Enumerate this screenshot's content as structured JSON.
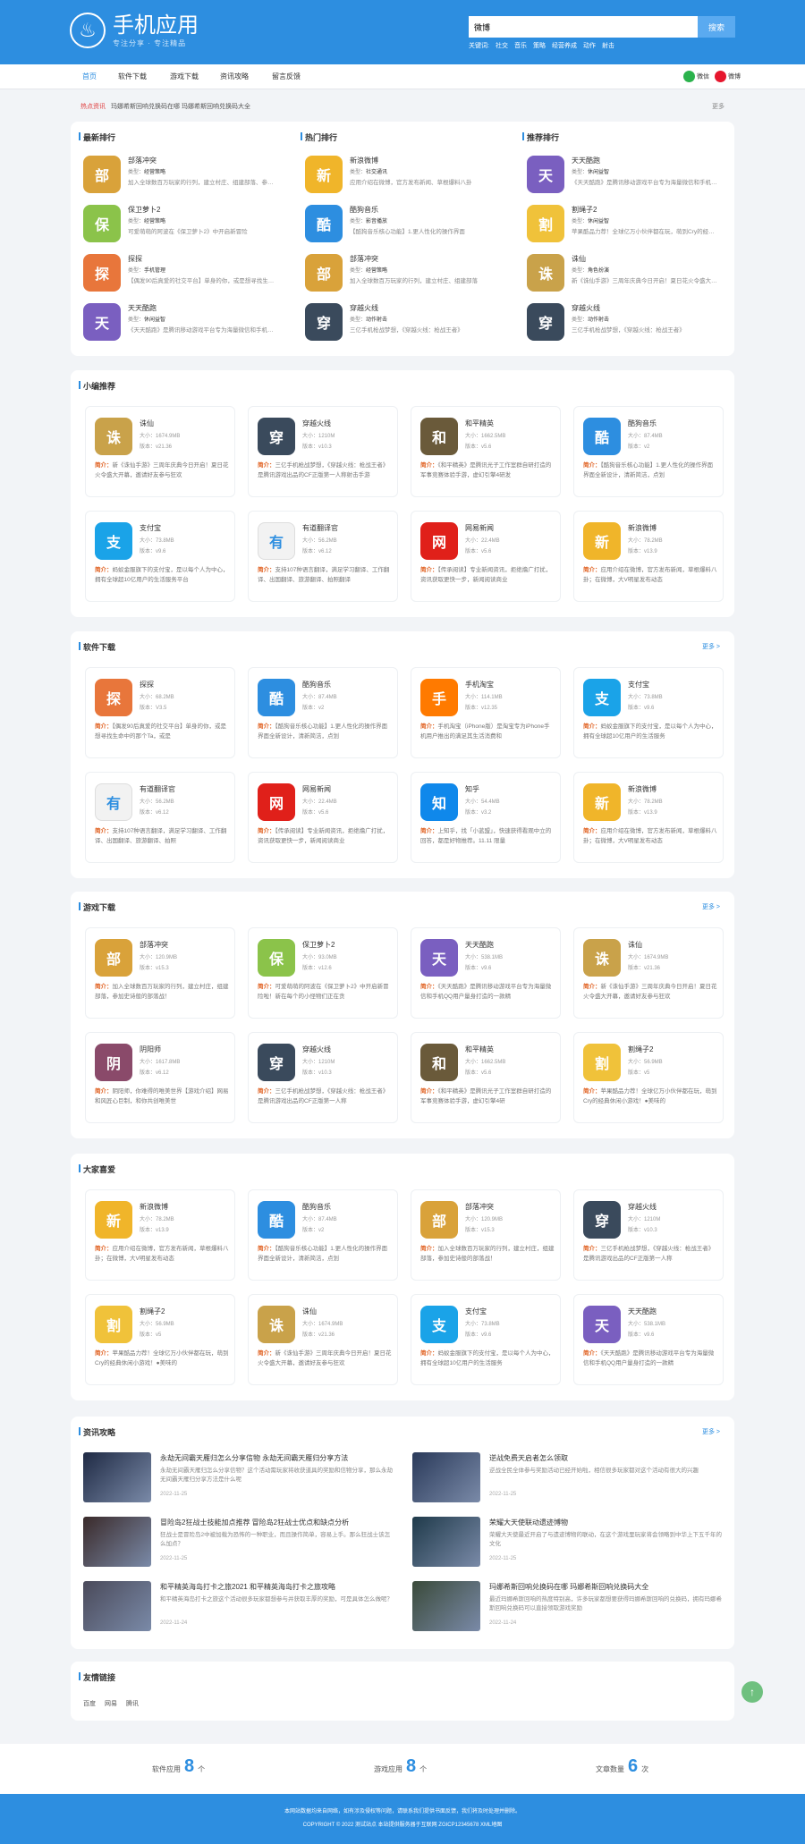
{
  "header": {
    "logo_text": "手机应用",
    "logo_sub": "专注分享 · 专注精品",
    "search_value": "微博",
    "search_button": "搜索",
    "keywords_label": "关键词:",
    "keywords": [
      "社交",
      "音乐",
      "策略",
      "经营养成",
      "动作",
      "射击"
    ]
  },
  "nav": {
    "items": [
      "首页",
      "软件下载",
      "游戏下载",
      "资讯攻略",
      "留言反馈"
    ],
    "share": [
      "微信",
      "微博"
    ]
  },
  "news_bar": {
    "label": "热点资讯",
    "text": "玛娜希斯回响兑换码在哪 玛娜希斯回响兑换码大全",
    "more": "更多"
  },
  "rank": {
    "columns": [
      {
        "title": "最新排行",
        "items": [
          {
            "name": "部落冲突",
            "type": "经营策略",
            "desc": "加入全球数百万玩家的行列，建立村庄、组建部落、参加史诗般的部落战"
          },
          {
            "name": "保卫萝卜2",
            "type": "经营策略",
            "desc": "可爱萌萌的阿波在《保卫萝卜2》中开启新冒险"
          },
          {
            "name": "探探",
            "type": "手机管理",
            "desc": "【偶发90后真爱的社交平台】单身的你，或是想寻找生命中的那个Ta"
          },
          {
            "name": "天天酷跑",
            "type": "休闲益智",
            "desc": "《天天酷跑》是腾讯移动游戏平台专为海量微信和手机QQ用户打造"
          }
        ]
      },
      {
        "title": "热门排行",
        "items": [
          {
            "name": "新浪微博",
            "type": "社交通讯",
            "desc": "应用介绍在微博，官方发布新闻、草根爆料八卦"
          },
          {
            "name": "酷狗音乐",
            "type": "影音播放",
            "desc": "【酷狗音乐核心功能】1.更人性化的操作界面"
          },
          {
            "name": "部落冲突",
            "type": "经营策略",
            "desc": "加入全球数百万玩家的行列，建立村庄、组建部落"
          },
          {
            "name": "穿越火线",
            "type": "动作射击",
            "desc": "三亿手机枪战梦想，《穿越火线：枪战王者》"
          }
        ]
      },
      {
        "title": "推荐排行",
        "items": [
          {
            "name": "天天酷跑",
            "type": "休闲益智",
            "desc": "《天天酷跑》是腾讯移动游戏平台专为海量微信和手机QQ用户打造"
          },
          {
            "name": "割绳子2",
            "type": "休闲益智",
            "desc": "苹果酷品力荐！全球亿万小伙伴都在玩，萌到Cry的经典休闲小游戏"
          },
          {
            "name": "诛仙",
            "type": "角色扮演",
            "desc": "新《诛仙手游》三周年庆典今日开启！夏日花火令盛大开幕"
          },
          {
            "name": "穿越火线",
            "type": "动作射击",
            "desc": "三亿手机枪战梦想，《穿越火线：枪战王者》"
          }
        ]
      }
    ]
  },
  "sections": [
    {
      "title": "小编推荐",
      "more": "",
      "items": [
        {
          "name": "诛仙",
          "size": "大小：1674.9MB",
          "ver": "版本：v21.36",
          "desc": "新《诛仙手游》三周年庆典今日开启！夏日花火令盛大开幕，邀请好友参与狂欢"
        },
        {
          "name": "穿越火线",
          "size": "大小：1210M",
          "ver": "版本：v10.3",
          "desc": "三亿手机枪战梦想，《穿越火线：枪战王者》是腾讯游戏出品的CF正版第一人称射击手游"
        },
        {
          "name": "和平精英",
          "size": "大小：1662.5MB",
          "ver": "版本：v5.6",
          "desc": "《和平精英》是腾讯光子工作室群自研打造的军事竞赛体验手游，虚幻引擎4研发"
        },
        {
          "name": "酷狗音乐",
          "size": "大小：87.4MB",
          "ver": "版本：v2",
          "desc": "【酷狗音乐核心功能】1.更人性化的操作界面界面全新设计，清新简洁，点划"
        },
        {
          "name": "支付宝",
          "size": "大小：73.8MB",
          "ver": "版本：v9.6",
          "desc": "蚂蚁金服旗下的支付宝，是以每个人为中心，拥有全球超10亿用户的生活服务平台"
        },
        {
          "name": "有道翻译官",
          "size": "大小：56.2MB",
          "ver": "版本：v6.12",
          "desc": "支持107种语言翻译，满足学习翻译、工作翻译、出国翻译、旅游翻译、拍照翻译"
        },
        {
          "name": "网易新闻",
          "size": "大小：22.4MB",
          "ver": "版本：v5.6",
          "desc": "【传承阅读】专业新闻资讯，拒绝撸广打扰，资讯获取更快一步，新闻阅读商业"
        },
        {
          "name": "新浪微博",
          "size": "大小：78.2MB",
          "ver": "版本：v13.9",
          "desc": "应用介绍在微博，官方发布新闻，草根爆料八卦；在微博，大V明星发布动态"
        }
      ]
    },
    {
      "title": "软件下载",
      "more": "更多 >",
      "items": [
        {
          "name": "探探",
          "size": "大小：68.2MB",
          "ver": "版本：V3.5",
          "desc": "【偶发90后真爱的社交平台】单身的你，或是想寻找生命中的那个Ta，或是"
        },
        {
          "name": "酷狗音乐",
          "size": "大小：87.4MB",
          "ver": "版本：v2",
          "desc": "【酷狗音乐核心功能】1.更人性化的操作界面界面全新设计，清新简洁，点划"
        },
        {
          "name": "手机淘宝",
          "size": "大小：114.1MB",
          "ver": "版本：v12.35",
          "desc": "手机淘宝（iPhone版）是淘宝专为iPhone手机用户推出的满足其生活消费和"
        },
        {
          "name": "支付宝",
          "size": "大小：73.8MB",
          "ver": "版本：v9.6",
          "desc": "蚂蚁金服旗下的支付宝，是以每个人为中心，拥有全球超10亿用户的生活服务"
        },
        {
          "name": "有道翻译官",
          "size": "大小：56.2MB",
          "ver": "版本：v6.12",
          "desc": "支持107种语言翻译，满足学习翻译、工作翻译、出国翻译、旅游翻译、拍照"
        },
        {
          "name": "网易新闻",
          "size": "大小：22.4MB",
          "ver": "版本：v5.6",
          "desc": "【传承阅读】专业新闻资讯，拒绝撸广打扰，资讯获取更快一步，新闻阅读商业"
        },
        {
          "name": "知乎",
          "size": "大小：54.4MB",
          "ver": "版本：v3.2",
          "desc": "上知乎，找「小蓝盟」，快速获得看观中立的回答，都是好物推荐。11.11 限量"
        },
        {
          "name": "新浪微博",
          "size": "大小：78.2MB",
          "ver": "版本：v13.9",
          "desc": "应用介绍在微博，官方发布新闻，草根爆料八卦；在微博，大V明星发布动态"
        }
      ]
    },
    {
      "title": "游戏下载",
      "more": "更多 >",
      "items": [
        {
          "name": "部落冲突",
          "size": "大小：120.9MB",
          "ver": "版本：v15.3",
          "desc": "加入全球数百万玩家的行列，建立村庄，组建部落，参加史诗般的部落战！"
        },
        {
          "name": "保卫萝卜2",
          "size": "大小：93.0MB",
          "ver": "版本：v12.6",
          "desc": "可爱萌萌的阿波在《保卫萝卜2》中开启新冒险啦！新在每个的小怪物们正在贪"
        },
        {
          "name": "天天酷跑",
          "size": "大小：538.1MB",
          "ver": "版本：v9.6",
          "desc": "《天天酷跑》是腾讯移动游戏平台专为海量微信和手机QQ用户量身打造的一款精"
        },
        {
          "name": "诛仙",
          "size": "大小：1674.9MB",
          "ver": "版本：v21.36",
          "desc": "新《诛仙手游》三周年庆典今日开启！夏日花火令盛大开幕，邀请好友参与狂欢"
        },
        {
          "name": "阴阳师",
          "size": "大小：1617.8MB",
          "ver": "版本：v6.12",
          "desc": "阴阳师，你难得的唯美世界【游戏介绍】网易和风匠心巨制，和你共创唯美世"
        },
        {
          "name": "穿越火线",
          "size": "大小：1210M",
          "ver": "版本：v10.3",
          "desc": "三亿手机枪战梦想，《穿越火线：枪战王者》是腾讯游戏出品的CF正版第一人称"
        },
        {
          "name": "和平精英",
          "size": "大小：1662.5MB",
          "ver": "版本：v5.6",
          "desc": "《和平精英》是腾讯光子工作室群自研打造的军事竞赛体验手游，虚幻引擎4研"
        },
        {
          "name": "割绳子2",
          "size": "大小：56.9MB",
          "ver": "版本：v5",
          "desc": "苹果酷品力荐！全球亿万小伙伴都在玩，萌到Cry的经典休闲小游戏！●美味的"
        }
      ]
    },
    {
      "title": "大家喜爱",
      "more": "",
      "items": [
        {
          "name": "新浪微博",
          "size": "大小：78.2MB",
          "ver": "版本：v13.9",
          "desc": "应用介绍在微博，官方发布新闻，草根爆料八卦；在微博，大V明星发布动态"
        },
        {
          "name": "酷狗音乐",
          "size": "大小：87.4MB",
          "ver": "版本：v2",
          "desc": "【酷狗音乐核心功能】1.更人性化的操作界面界面全新设计，清新简洁，点划"
        },
        {
          "name": "部落冲突",
          "size": "大小：120.9MB",
          "ver": "版本：v15.3",
          "desc": "加入全球数百万玩家的行列，建立村庄，组建部落，参加史诗般的部落战！"
        },
        {
          "name": "穿越火线",
          "size": "大小：1210M",
          "ver": "版本：v10.3",
          "desc": "三亿手机枪战梦想，《穿越火线：枪战王者》是腾讯游戏出品的CF正版第一人称"
        },
        {
          "name": "割绳子2",
          "size": "大小：56.9MB",
          "ver": "版本：v5",
          "desc": "苹果酷品力荐！全球亿万小伙伴都在玩，萌到Cry的经典休闲小游戏！●美味的"
        },
        {
          "name": "诛仙",
          "size": "大小：1674.9MB",
          "ver": "版本：v21.36",
          "desc": "新《诛仙手游》三周年庆典今日开启！夏日花火令盛大开幕，邀请好友参与狂欢"
        },
        {
          "name": "支付宝",
          "size": "大小：73.8MB",
          "ver": "版本：v9.6",
          "desc": "蚂蚁金服旗下的支付宝，是以每个人为中心，拥有全球超10亿用户的生活服务"
        },
        {
          "name": "天天酷跑",
          "size": "大小：538.1MB",
          "ver": "版本：v9.6",
          "desc": "《天天酷跑》是腾讯移动游戏平台专为海量微信和手机QQ用户量身打造的一款精"
        }
      ]
    }
  ],
  "desc_label": "简介：",
  "articles": {
    "title": "资讯攻略",
    "more": "更多 >",
    "items": [
      {
        "title": "永劫无间霸天雁归怎么分享信物 永劫无间霸天雁归分享方法",
        "desc": "永劫无间霸天雁归怎么分享信物？这个活动需玩家将收获道具的奖励和信物分享，那么永劫无间霸天雁归分享方法是什么呢",
        "date": "2022-11-25"
      },
      {
        "title": "逆战免费天启者怎么领取",
        "desc": "逆战全民全体参与奖励活动已经开始啦，相信很多玩家都对这个活动有很大的兴趣",
        "date": "2022-11-25"
      },
      {
        "title": "冒险岛2狂战士技能加点推荐 冒险岛2狂战士优点和缺点分析",
        "desc": "狂战士是冒险岛2中被加载为恐怖的一种职业，而且操作简单，容易上手。那么狂战士该怎么加点？",
        "date": "2022-11-25"
      },
      {
        "title": "荣耀大天使联动遗迹博物",
        "desc": "荣耀大天使最近开启了与遗迹博物的联动，在这个游戏里玩家将会领略到中华上下五千年的文化",
        "date": "2022-11-25"
      },
      {
        "title": "和平精英海岛打卡之旅2021 和平精英海岛打卡之旅攻略",
        "desc": "和平精英海岛打卡之旅这个活动很多玩家都想参与并获取丰厚的奖励，可是具体怎么做呢？",
        "date": "2022-11-24"
      },
      {
        "title": "玛娜希斯回响兑换码在哪 玛娜希斯回响兑换码大全",
        "desc": "最近玛娜希斯回响的热度特别高，许多玩家都想要获得玛娜希斯回响的兑换码，拥有玛娜希斯回响兑换码可以直接领取游戏奖励",
        "date": "2022-11-24"
      }
    ]
  },
  "friends": {
    "title": "友情链接",
    "items": [
      "百度",
      "网易",
      "腾讯"
    ]
  },
  "stats": [
    {
      "label": "软件应用",
      "value": "8",
      "unit": "个"
    },
    {
      "label": "游戏应用",
      "value": "8",
      "unit": "个"
    },
    {
      "label": "文章数量",
      "value": "6",
      "unit": "次"
    }
  ],
  "footer": {
    "line1": "本网站数据均来自网络，如有涉及侵权等问题，请联系我们提供书面反馈，我们将及时处理并删除。",
    "line2": "COPYRIGHT © 2022 测试站点 本站提供服务器于互联网 ZGICP12345678 XML地图"
  },
  "icon_colors": {
    "部落冲突": "#d9a23a",
    "保卫萝卜2": "#8bc34a",
    "探探": "#e8763b",
    "天天酷跑": "#7a5fc0",
    "新浪微博": "#f0b52a",
    "酷狗音乐": "#2d8ee0",
    "穿越火线": "#3a4a5c",
    "割绳子2": "#f0c23a",
    "诛仙": "#c9a24a",
    "和平精英": "#6a5a3a",
    "支付宝": "#1aa3e8",
    "有道翻译官": "#f2f2f2",
    "网易新闻": "#e0201a",
    "手机淘宝": "#ff7a00",
    "知乎": "#0f88eb",
    "阴阳师": "#8a4a6a"
  }
}
